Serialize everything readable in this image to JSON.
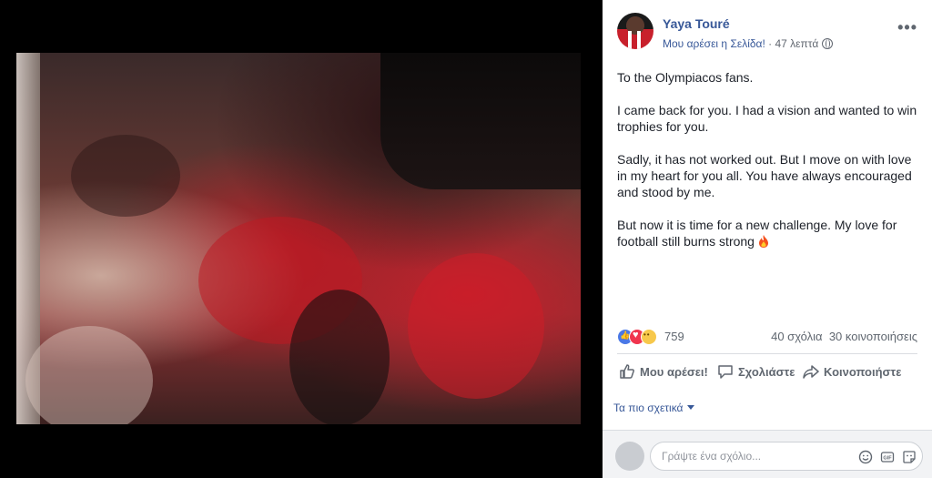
{
  "post": {
    "author": "Yaya Touré",
    "like_page": "Μου αρέσει η Σελίδα!",
    "separator": " · ",
    "time": "47 λεπτά",
    "paragraphs": [
      "To the Olympiacos fans.",
      "I came back for you. I had a vision and wanted to win trophies for you.",
      "Sadly, it has not worked out. But I move on with love in my heart for you all. You have always encouraged and stood by me.",
      "But now it is time for a new challenge. My love for football still burns strong"
    ],
    "reaction_count": "759",
    "comments_count": "40 σχόλια",
    "shares_count": "30 κοινοποιήσεις"
  },
  "actions": {
    "like": "Μου αρέσει!",
    "comment": "Σχολιάστε",
    "share": "Κοινοποιήστε"
  },
  "comments": {
    "sort_label": "Τα πιο σχετικά",
    "placeholder": "Γράψτε ένα σχόλιο..."
  },
  "icons": [
    "globe-icon",
    "more-icon",
    "fire-icon",
    "like-icon",
    "comment-icon",
    "share-icon",
    "emoji-icon",
    "gif-icon",
    "sticker-icon",
    "caret-icon"
  ],
  "colors": {
    "link": "#385898",
    "text": "#1d2129",
    "muted": "#606770",
    "like_reaction": "#4a78e6",
    "love_reaction": "#f0354e",
    "sad_reaction": "#f7c84b"
  }
}
